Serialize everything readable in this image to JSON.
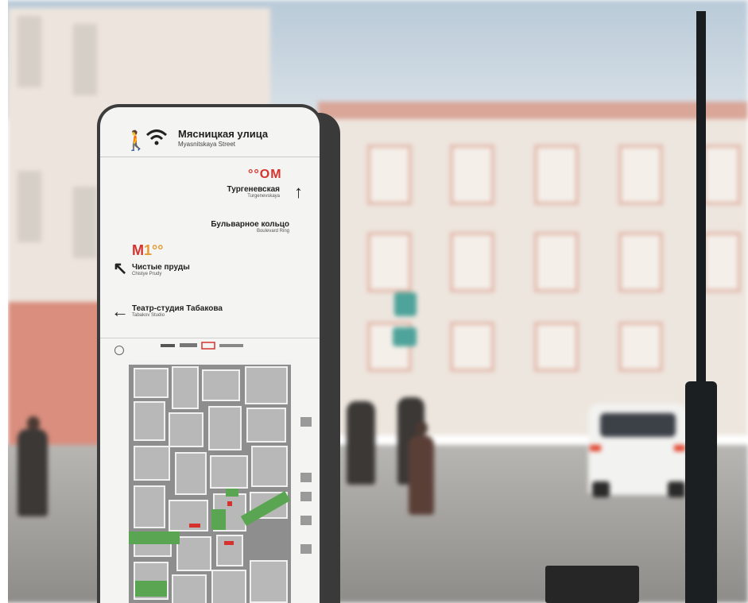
{
  "sign": {
    "street_ru": "Мясницкая улица",
    "street_en": "Myasnitskaya Street",
    "icons": [
      "pedestrian-icon",
      "wifi-icon"
    ],
    "metro_top": "°°ОМ",
    "dest1": {
      "ru": "Тургеневская",
      "en": "Turgenevskaya",
      "arrow": "↑"
    },
    "dest2": {
      "ru": "Бульварное кольцо",
      "en": "Boulevard Ring",
      "arrow": ""
    },
    "metro_mid": "М",
    "metro_mid_dots": "1°°",
    "dest3": {
      "ru": "Чистые пруды",
      "en": "Chistye Prudy",
      "arrow": "↖"
    },
    "dest4": {
      "ru": "Театр-студия Табакова",
      "en": "Tabakov Studio",
      "arrow": "←"
    }
  },
  "colors": {
    "metro_red": "#d6322d",
    "board_frame": "#3c3c3c",
    "board_face": "#f4f4f2",
    "park_green": "#5aa552"
  }
}
